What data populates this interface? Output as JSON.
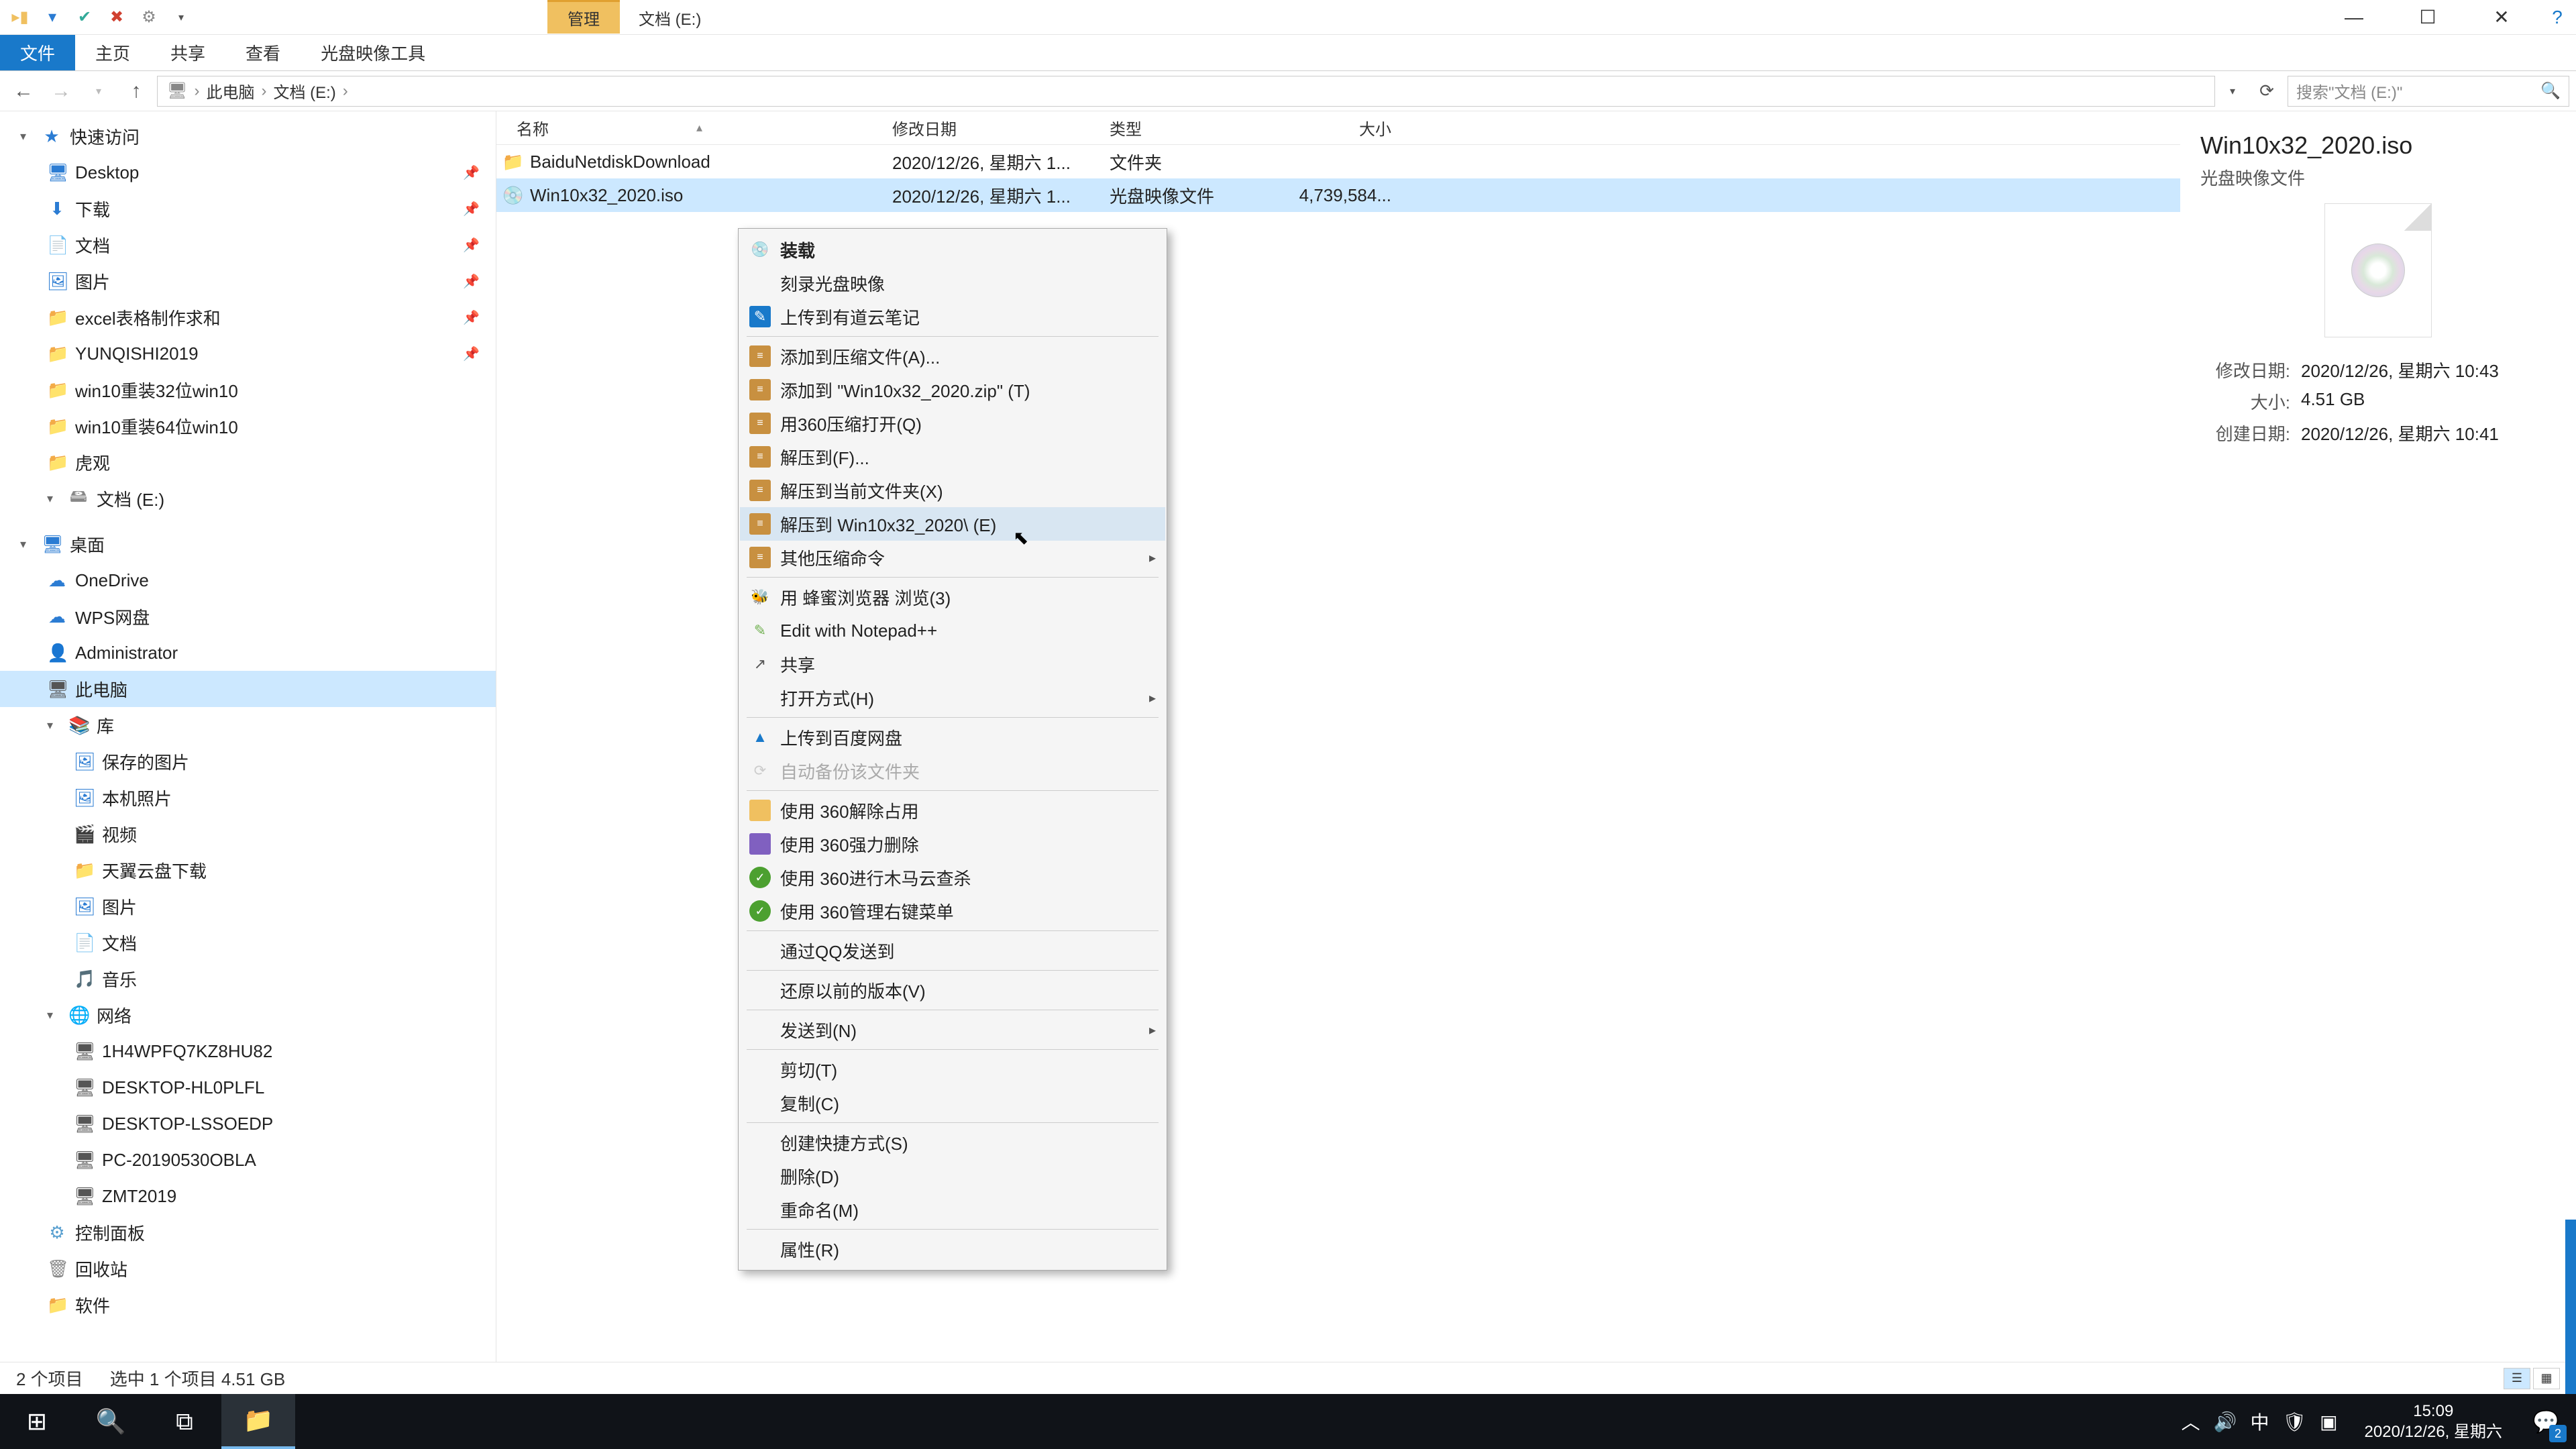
{
  "titlebar": {
    "context_tab": "管理",
    "title": "文档 (E:)"
  },
  "win_controls": {
    "min": "—",
    "max": "☐",
    "close": "✕",
    "help": "?"
  },
  "ribbon": {
    "file": "文件",
    "home": "主页",
    "share": "共享",
    "view": "查看",
    "iso_tools": "光盘映像工具"
  },
  "addr": {
    "back": "←",
    "fwd": "→",
    "up": "↑",
    "root": "此电脑",
    "drive": "文档 (E:)",
    "sep": "›",
    "search_placeholder": "搜索\"文档 (E:)\""
  },
  "tree": {
    "quick": "快速访问",
    "desktop": "Desktop",
    "downloads": "下载",
    "documents": "文档",
    "pictures": "图片",
    "excel": "excel表格制作求和",
    "yunqishi": "YUNQISHI2019",
    "win32": "win10重装32位win10",
    "win64": "win10重装64位win10",
    "huguan": "虎观",
    "docs_e": "文档 (E:)",
    "desktop2": "桌面",
    "onedrive": "OneDrive",
    "wps": "WPS网盘",
    "admin": "Administrator",
    "thispc": "此电脑",
    "lib": "库",
    "saved_pics": "保存的图片",
    "local_photos": "本机照片",
    "video": "视频",
    "tianyi": "天翼云盘下载",
    "pics2": "图片",
    "docs2": "文档",
    "music": "音乐",
    "network": "网络",
    "net1": "1H4WPFQ7KZ8HU82",
    "net2": "DESKTOP-HL0PLFL",
    "net3": "DESKTOP-LSSOEDP",
    "net4": "PC-20190530OBLA",
    "net5": "ZMT2019",
    "cpanel": "控制面板",
    "recycle": "回收站",
    "software": "软件"
  },
  "columns": {
    "name": "名称",
    "date": "修改日期",
    "type": "类型",
    "size": "大小"
  },
  "rows": [
    {
      "icon": "folder",
      "name": "BaiduNetdiskDownload",
      "date": "2020/12/26, 星期六 1...",
      "type": "文件夹",
      "size": ""
    },
    {
      "icon": "iso",
      "name": "Win10x32_2020.iso",
      "date": "2020/12/26, 星期六 1...",
      "type": "光盘映像文件",
      "size": "4,739,584..."
    }
  ],
  "details": {
    "title": "Win10x32_2020.iso",
    "subtitle": "光盘映像文件",
    "mod_label": "修改日期:",
    "mod_val": "2020/12/26, 星期六 10:43",
    "size_label": "大小:",
    "size_val": "4.51 GB",
    "create_label": "创建日期:",
    "create_val": "2020/12/26, 星期六 10:41"
  },
  "ctx": {
    "mount": "装载",
    "burn": "刻录光盘映像",
    "youdao": "上传到有道云笔记",
    "addzip": "添加到压缩文件(A)...",
    "addzip2": "添加到 \"Win10x32_2020.zip\" (T)",
    "open360": "用360压缩打开(Q)",
    "extractf": "解压到(F)...",
    "extractcur": "解压到当前文件夹(X)",
    "extractname": "解压到 Win10x32_2020\\ (E)",
    "othercomp": "其他压缩命令",
    "browser": "用 蜂蜜浏览器 浏览(3)",
    "npp": "Edit with Notepad++",
    "share": "共享",
    "openwith": "打开方式(H)",
    "baidu": "上传到百度网盘",
    "autobackup": "自动备份该文件夹",
    "unlock360": "使用 360解除占用",
    "delete360": "使用 360强力删除",
    "trojan360": "使用 360进行木马云查杀",
    "manage360": "使用 360管理右键菜单",
    "qq": "通过QQ发送到",
    "restore": "还原以前的版本(V)",
    "sendto": "发送到(N)",
    "cut": "剪切(T)",
    "copy": "复制(C)",
    "shortcut": "创建快捷方式(S)",
    "delete": "删除(D)",
    "rename": "重命名(M)",
    "props": "属性(R)"
  },
  "status": {
    "count": "2 个项目",
    "selected": "选中 1 个项目  4.51 GB"
  },
  "taskbar": {
    "time": "15:09",
    "date": "2020/12/26, 星期六",
    "ime": "中",
    "notif_count": "2"
  }
}
